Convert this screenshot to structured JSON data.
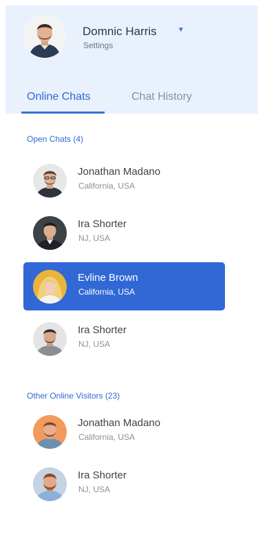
{
  "profile": {
    "name": "Domnic Harris",
    "subtitle": "Settings",
    "caret_icon": "caret-down-icon"
  },
  "tabs": [
    {
      "label": "Online Chats",
      "active": true
    },
    {
      "label": "Chat History",
      "active": false
    }
  ],
  "open_chats": {
    "title": "Open Chats (4)",
    "items": [
      {
        "name": "Jonathan Madano",
        "location": "California, USA",
        "selected": false
      },
      {
        "name": "Ira Shorter",
        "location": "NJ, USA",
        "selected": false
      },
      {
        "name": "Evline Brown",
        "location": "California, USA",
        "selected": true
      },
      {
        "name": "Ira Shorter",
        "location": "NJ, USA",
        "selected": false
      }
    ]
  },
  "other_visitors": {
    "title": "Other Online Visitors (23)",
    "items": [
      {
        "name": "Jonathan Madano",
        "location": "California, USA",
        "selected": false
      },
      {
        "name": "Ira Shorter",
        "location": "NJ, USA",
        "selected": false
      }
    ]
  },
  "colors": {
    "accent": "#3168d6",
    "header_bg": "#e9f1fd"
  }
}
